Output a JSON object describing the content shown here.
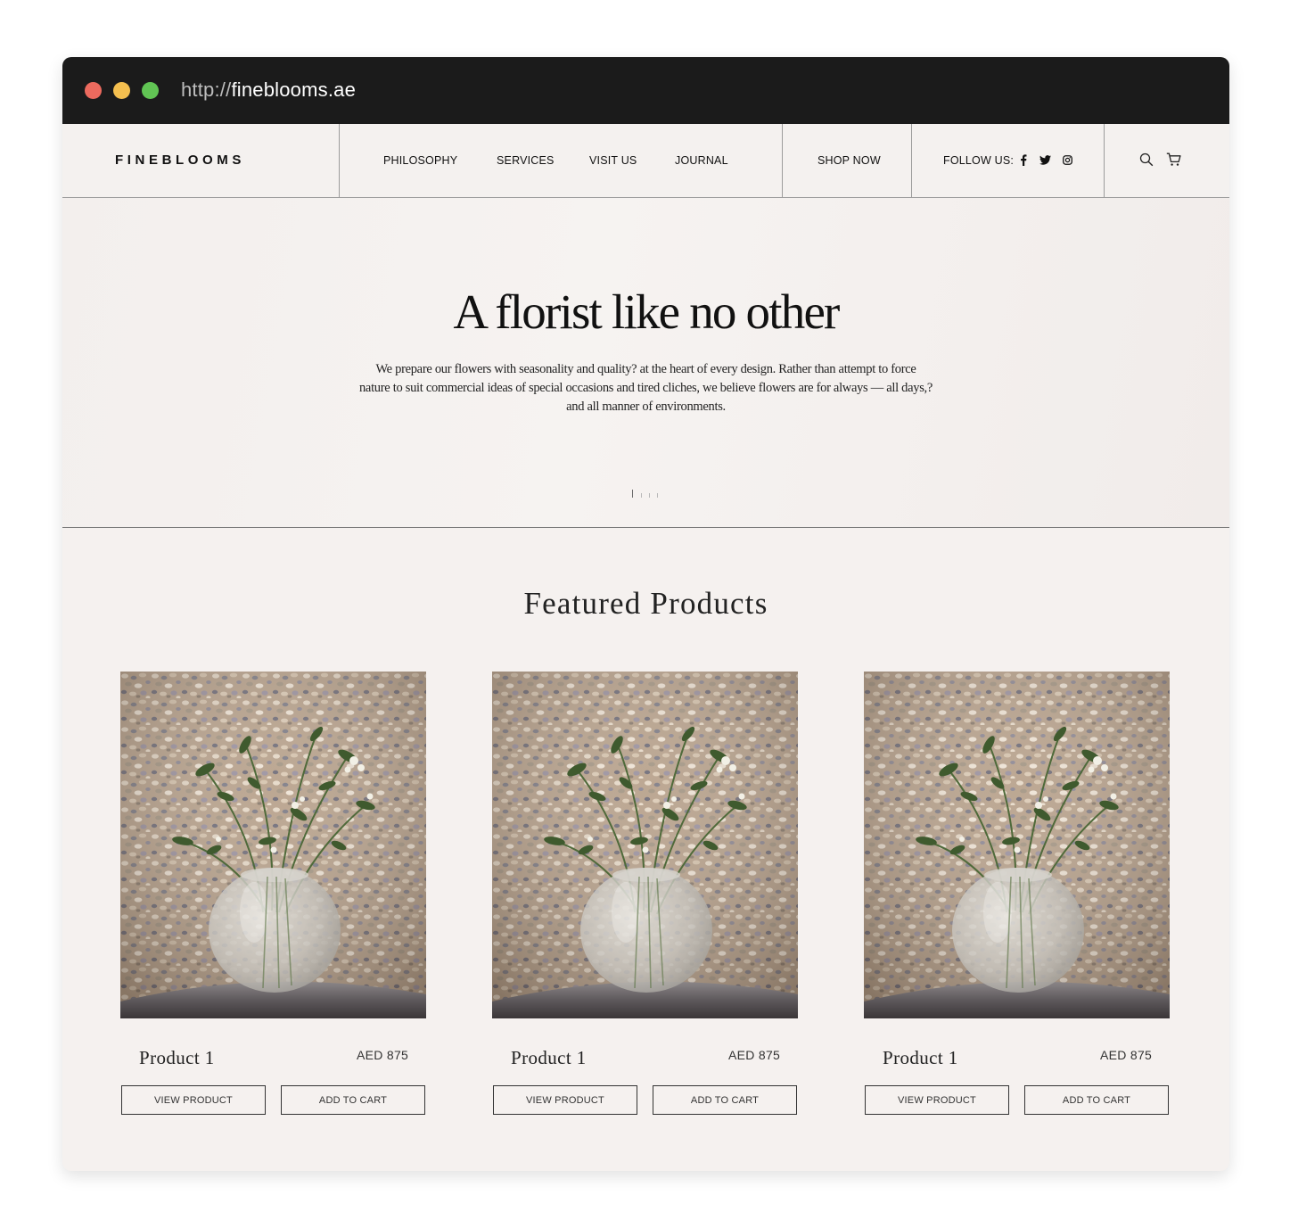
{
  "browser": {
    "url_protocol": "http://",
    "url_host": "fineblooms.ae"
  },
  "nav": {
    "logo": "FINEBLOOMS",
    "links": [
      "PHILOSOPHY",
      "SERVICES",
      "VISIT US",
      "JOURNAL"
    ],
    "shop": "SHOP NOW",
    "follow": "FOLLOW US:",
    "social_icons": [
      "facebook-icon",
      "twitter-icon",
      "instagram-icon"
    ],
    "utility_icons": [
      "search-icon",
      "cart-icon"
    ]
  },
  "hero": {
    "title": "A florist like no other",
    "description_lines": [
      "We prepare our flowers with seasonality and quality? at the heart of every design. Rather than attempt to force",
      "nature to suit commercial ideas of special occasions and tired cliches, we believe flowers are for always — all days,?",
      "and all manner of environments."
    ],
    "slides": 4,
    "active_slide": 1
  },
  "featured": {
    "title": "Featured Products",
    "products": [
      {
        "name": "Product 1",
        "price": "AED 875",
        "view_label": "VIEW PRODUCT",
        "cart_label": "ADD TO CART"
      },
      {
        "name": "Product 1",
        "price": "AED 875",
        "view_label": "VIEW PRODUCT",
        "cart_label": "ADD TO CART"
      },
      {
        "name": "Product 1",
        "price": "AED 875",
        "view_label": "VIEW PRODUCT",
        "cart_label": "ADD TO CART"
      }
    ]
  },
  "colors": {
    "titlebar": "#1b1b1b",
    "page_background": "#f5f1ef",
    "text": "#111111"
  }
}
